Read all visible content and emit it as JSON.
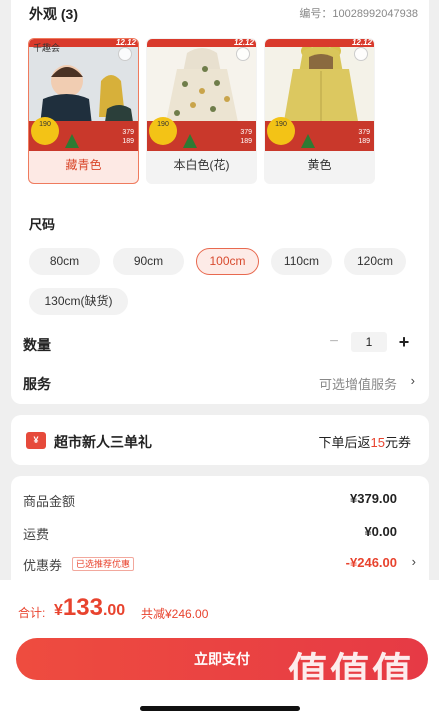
{
  "appearance": {
    "title": "外观 (3)",
    "sku": "编号：10028992047938"
  },
  "colors": [
    {
      "label": "藏青色",
      "selected": true,
      "badge": "190",
      "price": "379",
      "final": "189",
      "promo": "12.12",
      "logo": "千趣会"
    },
    {
      "label": "本白色(花)",
      "selected": false,
      "badge": "190",
      "price": "379",
      "final": "189",
      "promo": "12.12"
    },
    {
      "label": "黄色",
      "selected": false,
      "badge": "190",
      "price": "379",
      "final": "189",
      "promo": "12.12"
    }
  ],
  "size": {
    "title": "尺码",
    "options": [
      "80cm",
      "90cm",
      "100cm",
      "110cm",
      "120cm",
      "130cm(缺货)"
    ],
    "selected": "100cm"
  },
  "quantity": {
    "label": "数量",
    "value": "1",
    "minus": "−",
    "plus": "+"
  },
  "service": {
    "label": "服务",
    "value": "可选增值服务",
    "chevron": "›"
  },
  "promo": {
    "icon": "¥",
    "title": "超市新人三单礼",
    "right_prefix": "下单后返",
    "right_amount": "15",
    "right_suffix": "元券"
  },
  "summary": {
    "goods_label": "商品金额",
    "goods_value": "¥379.00",
    "shipping_label": "运费",
    "shipping_value": "¥0.00",
    "coupon_label": "优惠券",
    "coupon_tag": "已选推荐优惠",
    "coupon_value": "-¥246.00",
    "chevron": "›"
  },
  "footer": {
    "total_label": "合计:",
    "total_currency": "¥",
    "total_int": "133",
    "total_dec": ".00",
    "total_save": "共减¥246.00",
    "pay_label": "立即支付",
    "watermark_logo": "值值值",
    "watermark_url": "zhizhizhi.com"
  },
  "colors_theme": {
    "accent": "#e8432e",
    "selected_bg": "#fde9e4"
  }
}
